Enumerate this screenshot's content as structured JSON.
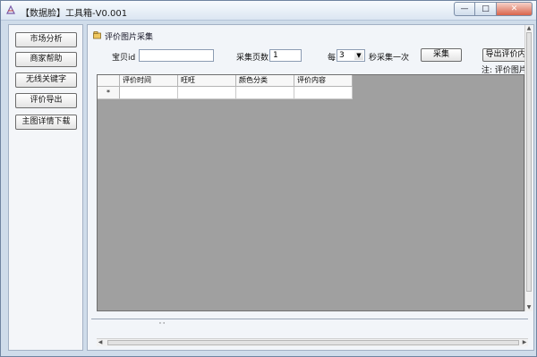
{
  "window": {
    "title": "【数据脸】工具箱-V0.001",
    "controls": [
      "—",
      "□",
      "✕"
    ]
  },
  "sidebar": {
    "items": [
      {
        "label": "市场分析"
      },
      {
        "label": "商家帮助"
      },
      {
        "label": "无线关键字"
      },
      {
        "label": "评价导出"
      },
      {
        "label": "主图详情下载"
      }
    ]
  },
  "panel": {
    "title": "评价图片采集",
    "baobei_label": "宝贝id",
    "baobei_value": "",
    "pages_label": "采集页数:",
    "pages_value": "1",
    "every_label": "每",
    "interval_value": "3",
    "interval_suffix": "秒采集一次",
    "collect_button": "采集",
    "export_button": "导出评价内",
    "note": "注: 评价图片"
  },
  "grid": {
    "columns": [
      "评价时间",
      "旺旺",
      "颜色分类",
      "评价内容"
    ],
    "new_row_marker": "*"
  }
}
